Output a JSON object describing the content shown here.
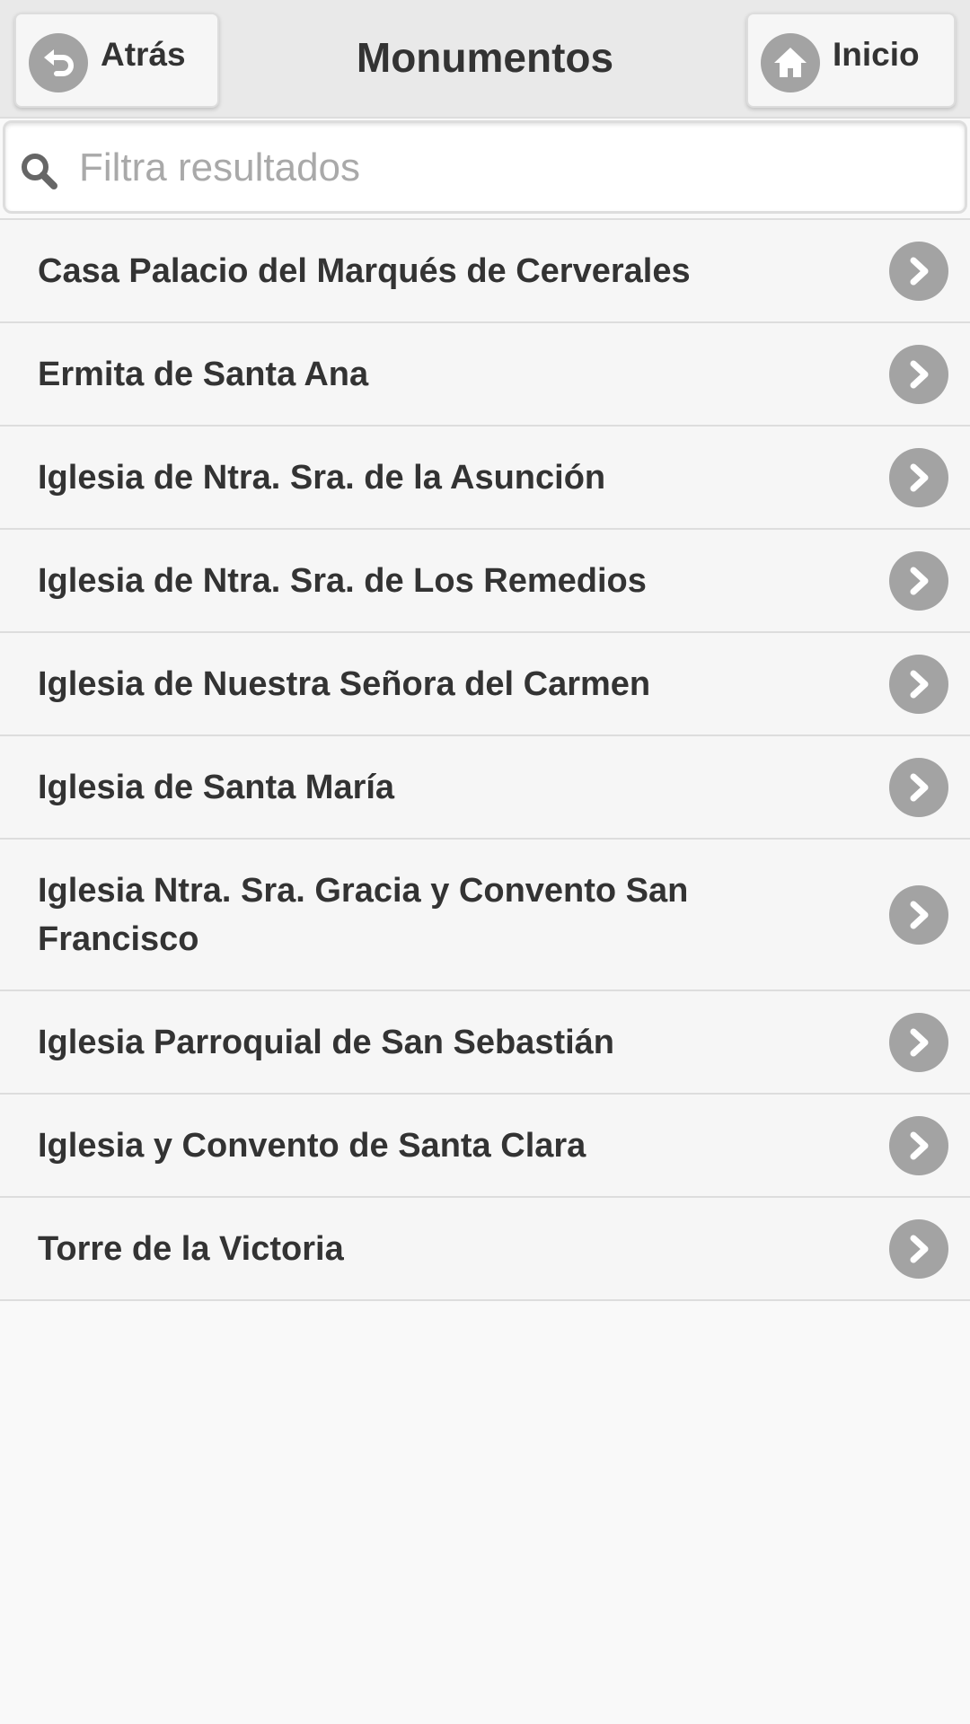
{
  "header": {
    "title": "Monumentos",
    "back_label": "Atrás",
    "home_label": "Inicio"
  },
  "search": {
    "placeholder": "Filtra resultados",
    "value": ""
  },
  "items": [
    {
      "label": "Casa Palacio del Marqués de Cerverales"
    },
    {
      "label": "Ermita de Santa Ana"
    },
    {
      "label": "Iglesia de Ntra. Sra. de la Asunción"
    },
    {
      "label": "Iglesia de Ntra. Sra. de Los Remedios"
    },
    {
      "label": "Iglesia de Nuestra Señora del Carmen"
    },
    {
      "label": "Iglesia de Santa María"
    },
    {
      "label": "Iglesia Ntra. Sra. Gracia y Convento San Francisco"
    },
    {
      "label": "Iglesia Parroquial de San Sebastián"
    },
    {
      "label": "Iglesia y Convento de Santa Clara"
    },
    {
      "label": "Torre de la Victoria"
    }
  ],
  "icons": {
    "back": "undo-arrow-icon",
    "home": "home-icon",
    "search": "search-icon",
    "row": "chevron-right-icon"
  },
  "colors": {
    "header_bg": "#e9e9e9",
    "icon_disc": "#a3a3a3",
    "text": "#333333",
    "row_bg": "#f6f6f6",
    "divider": "#dddddd"
  }
}
